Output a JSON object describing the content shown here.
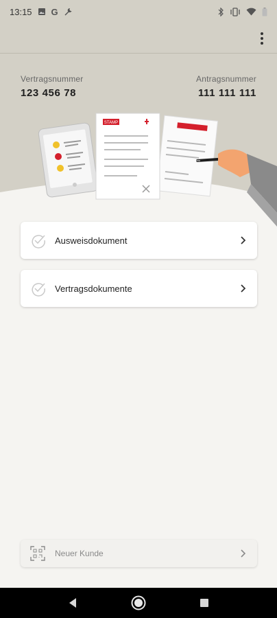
{
  "status_bar": {
    "time": "13:15",
    "left_icons": [
      "image-icon",
      "google-icon",
      "wrench-icon"
    ],
    "right_icons": [
      "bluetooth-icon",
      "vibrate-icon",
      "wifi-icon",
      "battery-icon"
    ]
  },
  "app_bar": {
    "menu_icon": "more-vert-icon"
  },
  "contract": {
    "label": "Vertragsnummer",
    "value": "123 456 78"
  },
  "application": {
    "label": "Antragsnummer",
    "value": "111 111 111"
  },
  "illustration": {
    "stamp_text": "STAMP"
  },
  "documents": [
    {
      "label": "Ausweisdokument",
      "icon": "check-circle-icon"
    },
    {
      "label": "Vertragsdokumente",
      "icon": "check-circle-icon"
    }
  ],
  "new_customer": {
    "label": "Neuer Kunde",
    "icon": "qr-scan-icon"
  },
  "colors": {
    "header_bg": "#d3d0c6",
    "page_bg": "#f5f4f1",
    "accent_red": "#d4202c",
    "accent_yellow": "#f0c12a"
  }
}
